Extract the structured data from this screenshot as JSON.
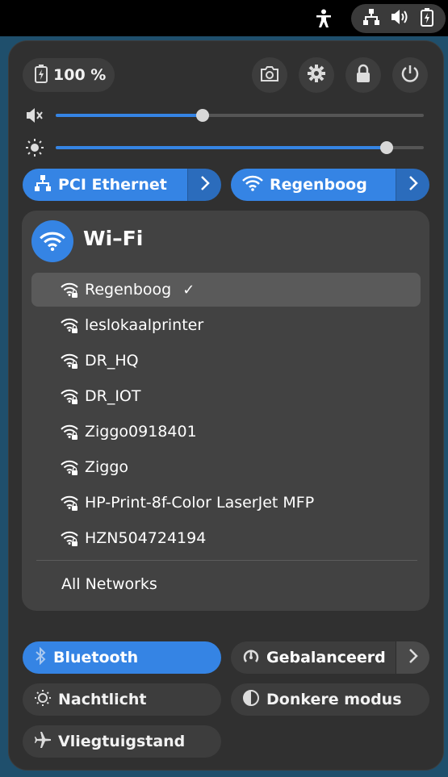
{
  "colors": {
    "accent": "#3584e4",
    "panel": "#303030",
    "topbar": "#000000"
  },
  "topbar": {
    "icons": [
      "accessibility-icon",
      "network-wired-icon",
      "volume-icon",
      "battery-icon"
    ]
  },
  "header": {
    "battery_label": "100 %",
    "actions": [
      "screenshot-icon",
      "settings-icon",
      "lock-icon",
      "power-icon"
    ]
  },
  "sliders": {
    "volume": {
      "icon": "volume-muted-icon",
      "level": 0.4
    },
    "brightness": {
      "icon": "brightness-icon",
      "level": 0.9
    }
  },
  "network_buttons": {
    "ethernet_label": "PCI Ethernet",
    "wifi_label": "Regenboog"
  },
  "wifi_menu": {
    "title": "Wi–Fi",
    "networks": [
      {
        "name": "Regenboog",
        "connected": true,
        "check": "✓"
      },
      {
        "name": "leslokaalprinter"
      },
      {
        "name": "DR_HQ"
      },
      {
        "name": "DR_IOT"
      },
      {
        "name": "Ziggo0918401"
      },
      {
        "name": "Ziggo"
      },
      {
        "name": "HP-Print-8f-Color LaserJet MFP"
      },
      {
        "name": "HZN504724194"
      }
    ],
    "all_networks_label": "All Networks"
  },
  "toggles": {
    "bluetooth": "Bluetooth",
    "power_mode": "Gebalanceerd",
    "night_light": "Nachtlicht",
    "dark_mode": "Donkere modus",
    "airplane": "Vliegtuigstand"
  }
}
